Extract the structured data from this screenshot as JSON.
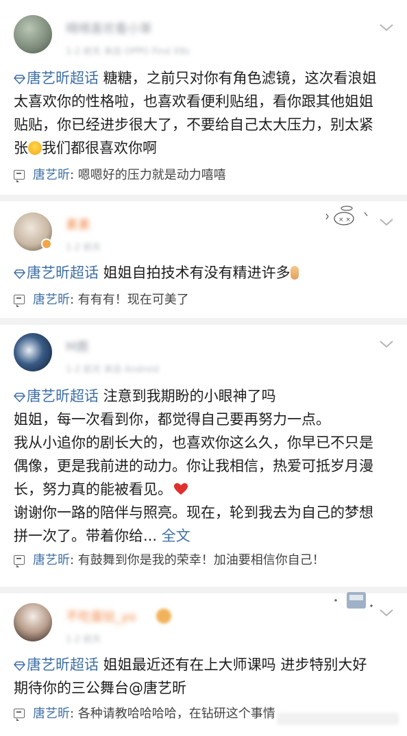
{
  "comments": [
    {
      "name": "晴晴喜欢看小笨",
      "meta": "1-2 前天 来自 OPPO Find X8s",
      "topic": "唐艺昕超话",
      "lines": [
        " 糖糖，之前只对你有角色滤镜，这次看浪姐",
        "太喜欢你的性格啦，也喜欢看便利贴组，看你跟其他姐姐",
        "贴贴，你已经进步很大了，不要给自己太大压力，别太紧",
        "张",
        "我们都很喜欢你啊"
      ],
      "reply_author": "唐艺昕",
      "reply_text": "嗯嗯好的压力就是动力嘻嘻"
    },
    {
      "name": "素素",
      "meta": "1-2 前天",
      "topic": "唐艺昕超话",
      "lines": [
        "  姐姐自拍技术有没有精进许多"
      ],
      "reply_author": "唐艺昕",
      "reply_text": "有有有！现在可美了"
    },
    {
      "name": "M鹿",
      "meta": "1-2 前天 来自 Android",
      "topic": "唐艺昕超话",
      "lines": [
        " 注意到我期盼的小眼神了吗",
        "姐姐，每一次看到你，都觉得自己要再努力一点。",
        "我从小追你的剧长大的，也喜欢你这么久，你早已不只是",
        "偶像，更是我前进的动力。你让我相信，热爱可抵岁月漫",
        "长，努力真的能被看见。",
        "谢谢你一路的陪伴与照亮。现在，轮到我去为自己的梦想",
        "拼一次了。带着你给..."
      ],
      "more": "全文",
      "reply_author": "唐艺昕",
      "reply_text": "有鼓舞到你是我的荣幸！加油要相信你自己！"
    },
    {
      "name": "不吃蛋挞_yo",
      "meta": "1-2 前天",
      "topic": "唐艺昕超话",
      "lines": [
        " 姐姐最近还有在上大师课吗 进步特别大好",
        "期待你的三公舞台@唐艺昕"
      ],
      "reply_author": "唐艺昕",
      "reply_text": "各种请教哈哈哈哈，在钻研这个事情"
    }
  ],
  "icons": {
    "topic": "diamond-topic-icon",
    "reply": "comment-reply-icon",
    "more": "chevron-down-icon"
  },
  "colors": {
    "link": "#3f6fa6",
    "separator": "#f2f2f2",
    "heart": "#e0302e"
  }
}
